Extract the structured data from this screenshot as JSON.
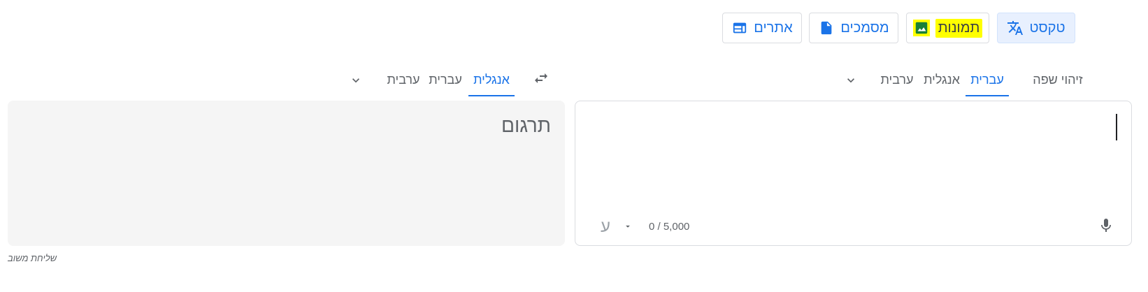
{
  "modes": {
    "text": "טקסט",
    "images": "תמונות",
    "documents": "מסמכים",
    "websites": "אתרים"
  },
  "source_langs": {
    "detect": "זיהוי שפה",
    "hebrew": "עברית",
    "english": "אנגלית",
    "arabic": "ערבית"
  },
  "target_langs": {
    "english": "אנגלית",
    "hebrew": "עברית",
    "arabic": "ערבית"
  },
  "source": {
    "char_count": "0 / 5,000",
    "keyboard_char": "ע"
  },
  "output": {
    "placeholder": "תרגום"
  },
  "feedback_label": "שליחת משוב",
  "colors": {
    "accent": "#1a73e8",
    "highlight": "#ffff00",
    "output_bg": "#f5f5f5"
  }
}
